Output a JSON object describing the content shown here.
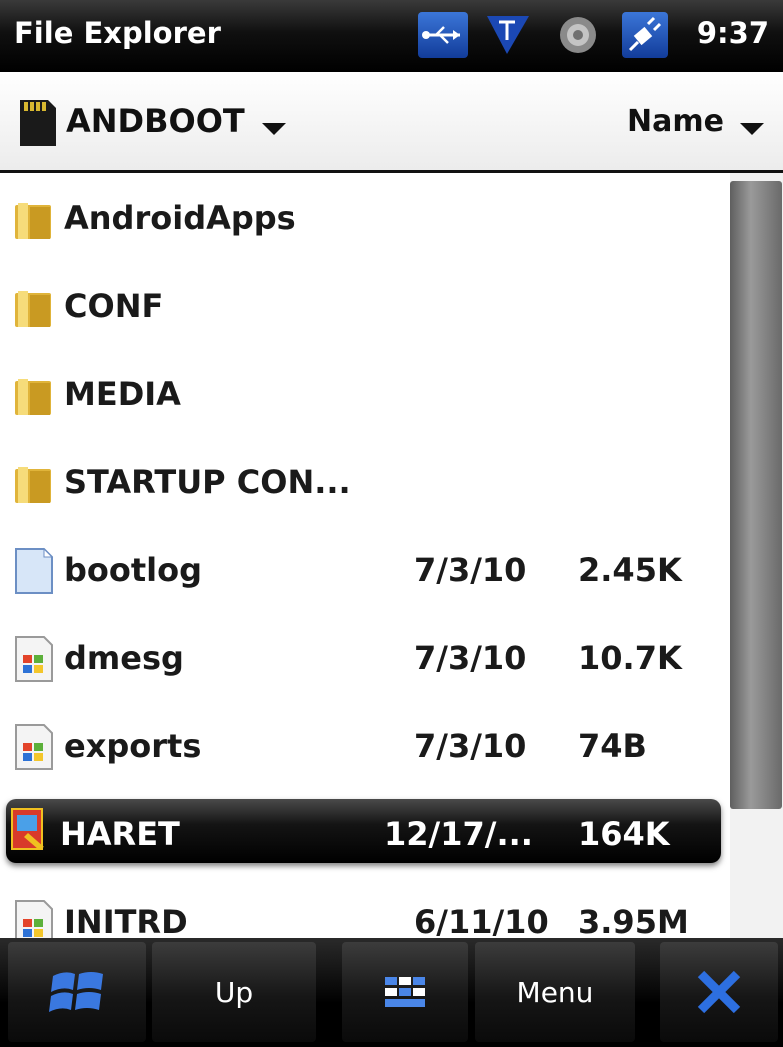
{
  "status_bar": {
    "title": "File Explorer",
    "time": "9:37",
    "icons": [
      "usb-icon",
      "signal-icon",
      "volume-icon",
      "power-icon"
    ]
  },
  "header": {
    "storage": "ANDBOOT",
    "sort": "Name"
  },
  "files": [
    {
      "name": "AndroidApps",
      "type": "folder",
      "date": "",
      "size": ""
    },
    {
      "name": "CONF",
      "type": "folder",
      "date": "",
      "size": ""
    },
    {
      "name": "MEDIA",
      "type": "folder",
      "date": "",
      "size": ""
    },
    {
      "name": "STARTUP CON...",
      "type": "folder",
      "date": "",
      "size": ""
    },
    {
      "name": "bootlog",
      "type": "file",
      "date": "7/3/10",
      "size": "2.45K"
    },
    {
      "name": "dmesg",
      "type": "winfile",
      "date": "7/3/10",
      "size": "10.7K"
    },
    {
      "name": "exports",
      "type": "winfile",
      "date": "7/3/10",
      "size": "74B"
    },
    {
      "name": "HARET",
      "type": "app",
      "date": "12/17/...",
      "size": "164K",
      "selected": true
    },
    {
      "name": "INITRD",
      "type": "winfile",
      "date": "6/11/10",
      "size": "3.95M"
    }
  ],
  "bottom_bar": {
    "up_label": "Up",
    "menu_label": "Menu"
  },
  "colors": {
    "selection": "#000000",
    "accent": "#1f4fc0"
  }
}
